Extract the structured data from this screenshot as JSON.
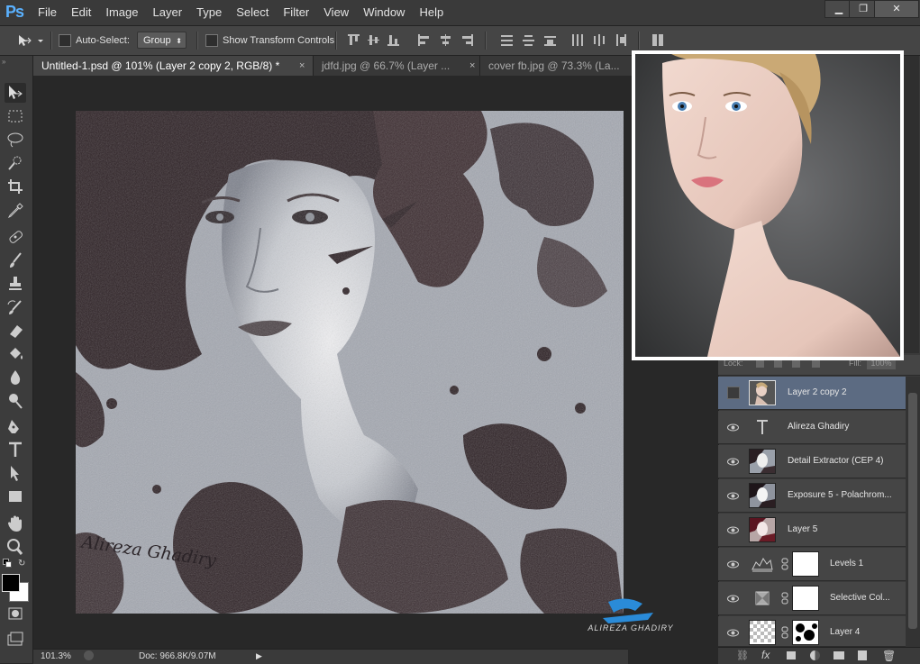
{
  "app": {
    "logo": "Ps"
  },
  "menu": [
    "File",
    "Edit",
    "Image",
    "Layer",
    "Type",
    "Select",
    "Filter",
    "View",
    "Window",
    "Help"
  ],
  "window_controls": {
    "minimize": "▁",
    "restore": "❐",
    "close": "✕"
  },
  "options": {
    "auto_select_label": "Auto-Select:",
    "auto_select_value": "Group",
    "transform_label": "Show Transform Controls"
  },
  "tabs": [
    {
      "label": "Untitled-1.psd @ 101% (Layer 2 copy 2, RGB/8) *",
      "close": "×"
    },
    {
      "label": "jdfd.jpg @ 66.7% (Layer ...",
      "close": "×"
    },
    {
      "label": "cover fb.jpg @ 73.3% (La..."
    }
  ],
  "artwork": {
    "signature": "Alireza Ghadiry"
  },
  "watermark": {
    "text": "ALIREZA GHADIRY"
  },
  "status": {
    "zoom": "101.3%",
    "doc": "Doc: 966.8K/9.07M"
  },
  "layers_panel": {
    "lock_label": "Lock:",
    "fill_label": "Fill:",
    "fill_value": "100%"
  },
  "layers": [
    {
      "name": "Layer 2 copy 2",
      "thumb": "portrait",
      "selected": true,
      "visible": false
    },
    {
      "name": "Alireza Ghadiry",
      "thumb": "type",
      "visible": true
    },
    {
      "name": "Detail Extractor (CEP 4)",
      "thumb": "art",
      "visible": true
    },
    {
      "name": "Exposure 5 - Polachrom...",
      "thumb": "art",
      "visible": true
    },
    {
      "name": "Layer 5",
      "thumb": "art-red",
      "visible": true
    },
    {
      "name": "Levels 1",
      "thumb": "levels",
      "mask": "white",
      "visible": true
    },
    {
      "name": "Selective Col...",
      "thumb": "selective",
      "mask": "white",
      "visible": true
    },
    {
      "name": "Layer 4",
      "thumb": "checker",
      "mask": "splatter",
      "visible": true
    }
  ],
  "colors": {
    "accent": "#5ab1ff",
    "selection": "#5c6b82",
    "panel": "#454545"
  }
}
